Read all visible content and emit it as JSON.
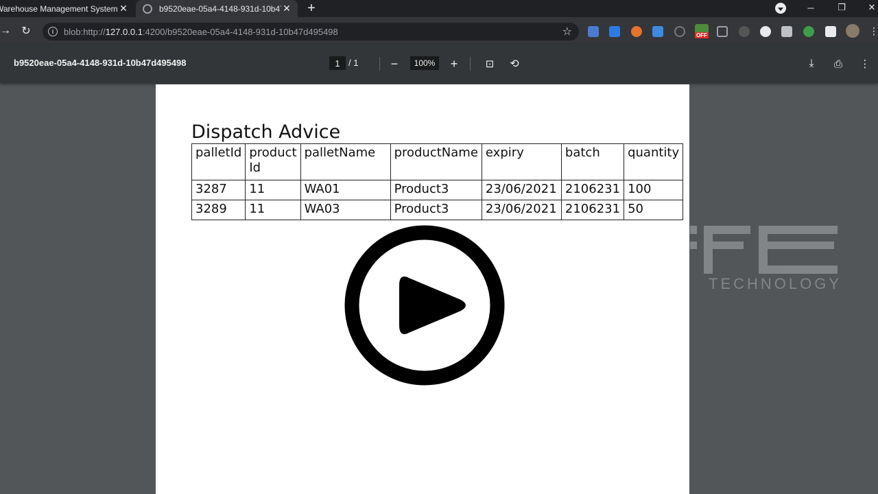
{
  "browser": {
    "tabs": [
      {
        "title": "Warehouse Management System",
        "active": false
      },
      {
        "title": "b9520eae-05a4-4148-931d-10b47d495498",
        "active": true
      }
    ],
    "url_prefix": "blob:http://",
    "url_host": "127.0.0.1",
    "url_rest": ":4200/b9520eae-05a4-4148-931d-10b47d495498",
    "extension_badge": "OFF"
  },
  "pdf_viewer": {
    "file_title": "b9520eae-05a4-4148-931d-10b47d495498",
    "page_current": "1",
    "page_total": "/ 1",
    "zoom": "100%"
  },
  "document": {
    "title": "Dispatch Advice",
    "columns": [
      "palletId",
      "product Id",
      "palletName",
      "productName",
      "expiry",
      "batch",
      "quantity"
    ],
    "rows": [
      [
        "3287",
        "11",
        "WA01",
        "Product3",
        "23/06/2021",
        "2106231",
        "100"
      ],
      [
        "3289",
        "11",
        "WA03",
        "Product3",
        "23/06/2021",
        "2106231",
        "50"
      ]
    ]
  },
  "watermark": {
    "text": "TECHNOLOGY"
  }
}
